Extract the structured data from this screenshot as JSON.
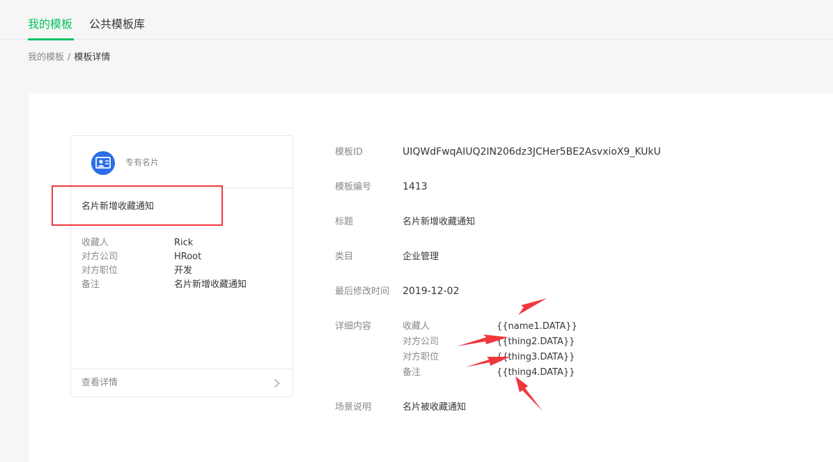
{
  "tabs": {
    "my_templates": "我的模板",
    "public_library": "公共模板库"
  },
  "breadcrumb": {
    "parent": "我的模板",
    "separator": "/",
    "current": "模板详情"
  },
  "preview_card": {
    "brand_name": "专有名片",
    "title": "名片新增收藏通知",
    "fields": [
      {
        "key": "收藏人",
        "value": "Rick"
      },
      {
        "key": "对方公司",
        "value": "HRoot"
      },
      {
        "key": "对方职位",
        "value": "开发"
      },
      {
        "key": "备注",
        "value": "名片新增收藏通知"
      }
    ],
    "footer_label": "查看详情"
  },
  "details": {
    "template_id_label": "模板ID",
    "template_id": "UIQWdFwqAIUQ2IN206dz3JCHer5BE2AsvxioX9_KUkU",
    "template_no_label": "模板编号",
    "template_no": "1413",
    "title_label": "标题",
    "title": "名片新增收藏通知",
    "category_label": "类目",
    "category": "企业管理",
    "modified_label": "最后修改时间",
    "modified": "2019-12-02",
    "content_label": "详细内容",
    "content": [
      {
        "key": "收藏人",
        "value": "{{name1.DATA}}"
      },
      {
        "key": "对方公司",
        "value": "{{thing2.DATA}}"
      },
      {
        "key": "对方职位",
        "value": "{{thing3.DATA}}"
      },
      {
        "key": "备注",
        "value": "{{thing4.DATA}}"
      }
    ],
    "scene_label": "场景说明",
    "scene": "名片被收藏通知"
  },
  "colors": {
    "accent": "#07c160",
    "annotation": "#f0383c",
    "avatar": "#2a6ee8"
  }
}
